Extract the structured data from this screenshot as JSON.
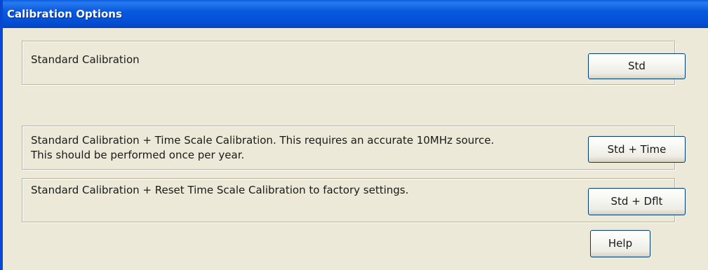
{
  "window": {
    "title": "Calibration Options"
  },
  "options": [
    {
      "description_lines": [
        "Standard Calibration"
      ],
      "button_label": "Std"
    },
    {
      "description_lines": [
        "Standard Calibration + Time Scale Calibration.  This requires an accurate 10MHz source.",
        "This should be performed once per year."
      ],
      "button_label": "Std + Time"
    },
    {
      "description_lines": [
        "Standard Calibration + Reset Time Scale Calibration to factory settings."
      ],
      "button_label": "Std + Dflt"
    }
  ],
  "help_label": "Help",
  "colors": {
    "titlebar": "#0552d8",
    "window_background": "#ece9d8",
    "button_border": "#003c74"
  }
}
